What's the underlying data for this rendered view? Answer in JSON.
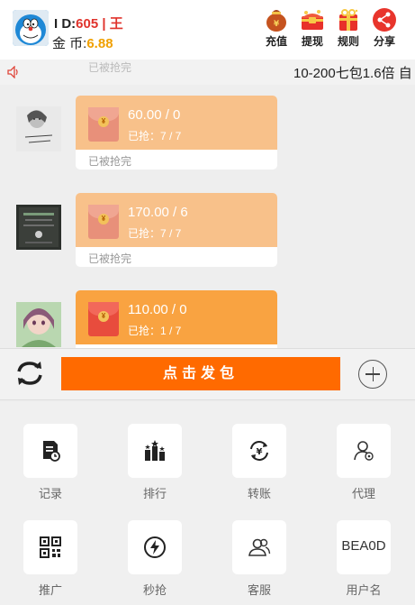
{
  "header": {
    "id_label": "I D:",
    "id_value": "605 | 王",
    "coin_label": "金 币:",
    "coin_value": "6.88",
    "buttons": [
      {
        "label": "充值",
        "icon": "money-bag-icon"
      },
      {
        "label": "提现",
        "icon": "treasure-chest-icon"
      },
      {
        "label": "规则",
        "icon": "rules-gift-icon"
      },
      {
        "label": "分享",
        "icon": "share-icon"
      }
    ]
  },
  "marquee": {
    "text": "10-200七包1.6倍 自",
    "ghost_text": "已被抢完"
  },
  "messages": [
    {
      "amount": "60.00 / 0",
      "grabbed": "已抢：7 / 7",
      "status": "已被抢完",
      "color": "#f8c18a",
      "envelope": "#e8907a"
    },
    {
      "amount": "170.00 / 6",
      "grabbed": "已抢：7 / 7",
      "status": "已被抢完",
      "color": "#f8c18a",
      "envelope": "#e8907a"
    },
    {
      "amount": "110.00 / 0",
      "grabbed": "已抢：1 / 7",
      "status": "",
      "color": "#f9a341",
      "envelope": "#e84c3d"
    }
  ],
  "sendbar": {
    "send_label": "点击发包"
  },
  "menu": [
    {
      "label": "记录",
      "icon": "record-icon"
    },
    {
      "label": "排行",
      "icon": "ranking-icon"
    },
    {
      "label": "转账",
      "icon": "transfer-icon"
    },
    {
      "label": "代理",
      "icon": "agent-icon"
    },
    {
      "label": "推广",
      "icon": "qrcode-icon"
    },
    {
      "label": "秒抢",
      "icon": "lightning-icon"
    },
    {
      "label": "客服",
      "icon": "customer-service-icon"
    },
    {
      "label": "用户名",
      "box_text": "BEA0D"
    }
  ]
}
